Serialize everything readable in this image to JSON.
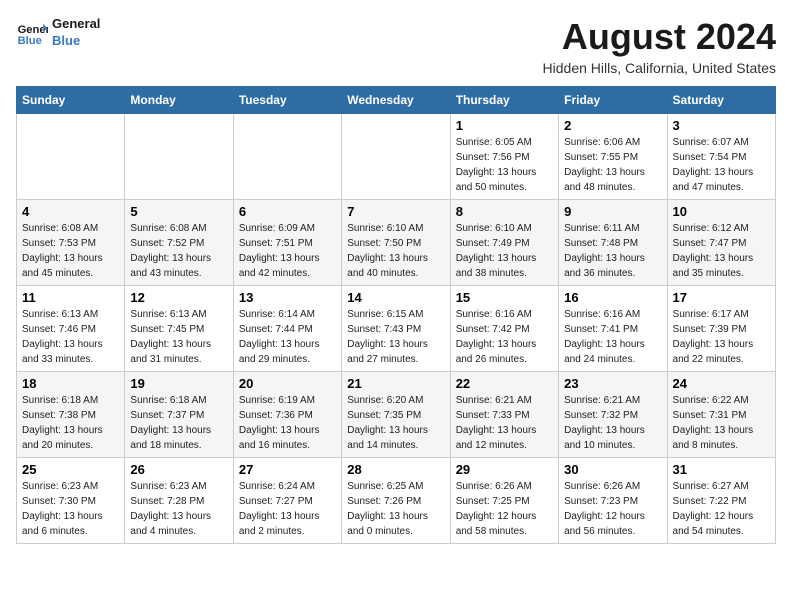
{
  "logo": {
    "line1": "General",
    "line2": "Blue"
  },
  "title": "August 2024",
  "location": "Hidden Hills, California, United States",
  "days_header": [
    "Sunday",
    "Monday",
    "Tuesday",
    "Wednesday",
    "Thursday",
    "Friday",
    "Saturday"
  ],
  "weeks": [
    [
      {
        "day": "",
        "info": ""
      },
      {
        "day": "",
        "info": ""
      },
      {
        "day": "",
        "info": ""
      },
      {
        "day": "",
        "info": ""
      },
      {
        "day": "1",
        "info": "Sunrise: 6:05 AM\nSunset: 7:56 PM\nDaylight: 13 hours\nand 50 minutes."
      },
      {
        "day": "2",
        "info": "Sunrise: 6:06 AM\nSunset: 7:55 PM\nDaylight: 13 hours\nand 48 minutes."
      },
      {
        "day": "3",
        "info": "Sunrise: 6:07 AM\nSunset: 7:54 PM\nDaylight: 13 hours\nand 47 minutes."
      }
    ],
    [
      {
        "day": "4",
        "info": "Sunrise: 6:08 AM\nSunset: 7:53 PM\nDaylight: 13 hours\nand 45 minutes."
      },
      {
        "day": "5",
        "info": "Sunrise: 6:08 AM\nSunset: 7:52 PM\nDaylight: 13 hours\nand 43 minutes."
      },
      {
        "day": "6",
        "info": "Sunrise: 6:09 AM\nSunset: 7:51 PM\nDaylight: 13 hours\nand 42 minutes."
      },
      {
        "day": "7",
        "info": "Sunrise: 6:10 AM\nSunset: 7:50 PM\nDaylight: 13 hours\nand 40 minutes."
      },
      {
        "day": "8",
        "info": "Sunrise: 6:10 AM\nSunset: 7:49 PM\nDaylight: 13 hours\nand 38 minutes."
      },
      {
        "day": "9",
        "info": "Sunrise: 6:11 AM\nSunset: 7:48 PM\nDaylight: 13 hours\nand 36 minutes."
      },
      {
        "day": "10",
        "info": "Sunrise: 6:12 AM\nSunset: 7:47 PM\nDaylight: 13 hours\nand 35 minutes."
      }
    ],
    [
      {
        "day": "11",
        "info": "Sunrise: 6:13 AM\nSunset: 7:46 PM\nDaylight: 13 hours\nand 33 minutes."
      },
      {
        "day": "12",
        "info": "Sunrise: 6:13 AM\nSunset: 7:45 PM\nDaylight: 13 hours\nand 31 minutes."
      },
      {
        "day": "13",
        "info": "Sunrise: 6:14 AM\nSunset: 7:44 PM\nDaylight: 13 hours\nand 29 minutes."
      },
      {
        "day": "14",
        "info": "Sunrise: 6:15 AM\nSunset: 7:43 PM\nDaylight: 13 hours\nand 27 minutes."
      },
      {
        "day": "15",
        "info": "Sunrise: 6:16 AM\nSunset: 7:42 PM\nDaylight: 13 hours\nand 26 minutes."
      },
      {
        "day": "16",
        "info": "Sunrise: 6:16 AM\nSunset: 7:41 PM\nDaylight: 13 hours\nand 24 minutes."
      },
      {
        "day": "17",
        "info": "Sunrise: 6:17 AM\nSunset: 7:39 PM\nDaylight: 13 hours\nand 22 minutes."
      }
    ],
    [
      {
        "day": "18",
        "info": "Sunrise: 6:18 AM\nSunset: 7:38 PM\nDaylight: 13 hours\nand 20 minutes."
      },
      {
        "day": "19",
        "info": "Sunrise: 6:18 AM\nSunset: 7:37 PM\nDaylight: 13 hours\nand 18 minutes."
      },
      {
        "day": "20",
        "info": "Sunrise: 6:19 AM\nSunset: 7:36 PM\nDaylight: 13 hours\nand 16 minutes."
      },
      {
        "day": "21",
        "info": "Sunrise: 6:20 AM\nSunset: 7:35 PM\nDaylight: 13 hours\nand 14 minutes."
      },
      {
        "day": "22",
        "info": "Sunrise: 6:21 AM\nSunset: 7:33 PM\nDaylight: 13 hours\nand 12 minutes."
      },
      {
        "day": "23",
        "info": "Sunrise: 6:21 AM\nSunset: 7:32 PM\nDaylight: 13 hours\nand 10 minutes."
      },
      {
        "day": "24",
        "info": "Sunrise: 6:22 AM\nSunset: 7:31 PM\nDaylight: 13 hours\nand 8 minutes."
      }
    ],
    [
      {
        "day": "25",
        "info": "Sunrise: 6:23 AM\nSunset: 7:30 PM\nDaylight: 13 hours\nand 6 minutes."
      },
      {
        "day": "26",
        "info": "Sunrise: 6:23 AM\nSunset: 7:28 PM\nDaylight: 13 hours\nand 4 minutes."
      },
      {
        "day": "27",
        "info": "Sunrise: 6:24 AM\nSunset: 7:27 PM\nDaylight: 13 hours\nand 2 minutes."
      },
      {
        "day": "28",
        "info": "Sunrise: 6:25 AM\nSunset: 7:26 PM\nDaylight: 13 hours\nand 0 minutes."
      },
      {
        "day": "29",
        "info": "Sunrise: 6:26 AM\nSunset: 7:25 PM\nDaylight: 12 hours\nand 58 minutes."
      },
      {
        "day": "30",
        "info": "Sunrise: 6:26 AM\nSunset: 7:23 PM\nDaylight: 12 hours\nand 56 minutes."
      },
      {
        "day": "31",
        "info": "Sunrise: 6:27 AM\nSunset: 7:22 PM\nDaylight: 12 hours\nand 54 minutes."
      }
    ]
  ]
}
